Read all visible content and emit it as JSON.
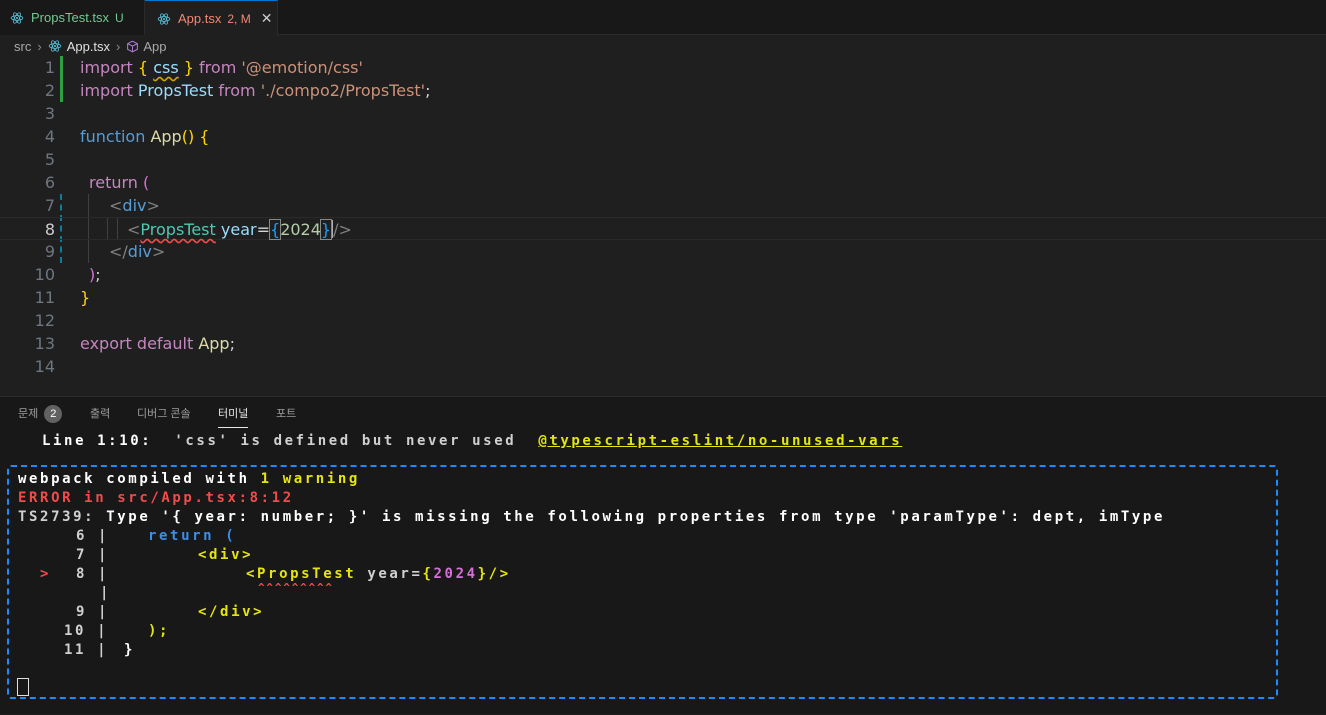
{
  "tabs": [
    {
      "name": "PropsTest.tsx",
      "status": "U"
    },
    {
      "name": "App.tsx",
      "status": "2, M",
      "close": "✕"
    }
  ],
  "breadcrumb": {
    "folder": "src",
    "file": "App.tsx",
    "symbol": "App"
  },
  "editor": {
    "line_numbers": [
      "1",
      "2",
      "3",
      "4",
      "5",
      "6",
      "7",
      "8",
      "9",
      "10",
      "11",
      "12",
      "13",
      "14"
    ],
    "line1": {
      "import": "import",
      "ob": "{",
      "css": "css",
      "cb": "}",
      "from": "from",
      "str": "'@emotion/css'"
    },
    "line2": {
      "import": "import",
      "ident": "PropsTest",
      "from": "from",
      "str": "'./compo2/PropsTest'",
      "semi": ";"
    },
    "line4": {
      "function": "function",
      "name": "App",
      "parens": "()",
      "brace": "{"
    },
    "line6": {
      "return": "return",
      "paren": "("
    },
    "line7": {
      "open": "<",
      "tag": "div",
      "close": ">"
    },
    "line8": {
      "open": "<",
      "comp": "PropsTest",
      "attr": "year",
      "eq": "=",
      "ob": "{",
      "num": "2024",
      "cb": "}",
      "close": "/>"
    },
    "line9": {
      "open": "</",
      "tag": "div",
      "close": ">"
    },
    "line10": {
      "paren": ")",
      "semi": ";"
    },
    "line11": {
      "brace": "}"
    },
    "line13": {
      "export": "export",
      "default": "default",
      "ident": "App",
      "semi": ";"
    }
  },
  "panel": {
    "tabs": [
      "문제",
      "출력",
      "디버그 콘솔",
      "터미널",
      "포트"
    ],
    "problem_count": "2",
    "active_tab": "터미널"
  },
  "terminal": {
    "lint_prefix": "Line 1:10:",
    "lint_msg": "'css' is defined but never used",
    "lint_rule": "@typescript-eslint/no-unused-vars",
    "compiled_a": "webpack compiled with ",
    "compiled_b": "1 warning",
    "error_label": "ERROR in src/App.tsx:8:12",
    "ts_code": "TS2739:",
    "ts_msg": "Type '{ year: number; }' is missing the following properties from type 'paramType': dept, imType",
    "l6_num": "6 |",
    "l6_code": "return (",
    "l7_num": "7 |",
    "l7_code": "<div>",
    "l8_marker": ">",
    "l8_num": "8 |",
    "l8_open": "<PropsTest ",
    "l8_attr": "year=",
    "l8_ob": "{",
    "l8_val": "2024",
    "l8_cb": "}",
    "l8_close": "/>",
    "carets_bar": "|",
    "carets": "^^^^^^^^^",
    "l9_num": "9 |",
    "l9_code": "</div>",
    "l10_num": "10 |",
    "l10_code": ");",
    "l11_num": "11 |",
    "l11_code": "}"
  }
}
